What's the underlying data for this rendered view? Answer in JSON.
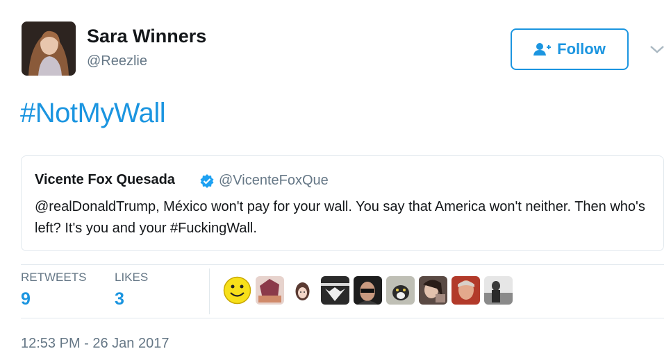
{
  "tweet": {
    "author_name": "Sara Winners",
    "author_handle": "@Reezlie",
    "follow_label": "Follow",
    "hashtag": "#NotMyWall",
    "timestamp": "12:53 PM - 26 Jan 2017"
  },
  "quoted": {
    "author_name": "Vicente Fox Quesada",
    "author_handle": "@VicenteFoxQue",
    "text": "@realDonaldTrump, México won't pay for your wall. You say that America won't neither. Then who's left? It's you and your #FuckingWall."
  },
  "stats": {
    "retweets_label": "RETWEETS",
    "retweets_count": "9",
    "likes_label": "LIKES",
    "likes_count": "3"
  },
  "likers": [
    "smiley-icon",
    "liker-avatar-2",
    "liker-avatar-3",
    "liker-avatar-4",
    "liker-avatar-5",
    "liker-avatar-6",
    "liker-avatar-7",
    "liker-avatar-8",
    "liker-avatar-9"
  ],
  "colors": {
    "accent": "#1b95e0",
    "text": "#14171a",
    "muted": "#657786",
    "border": "#e1e8ed"
  }
}
